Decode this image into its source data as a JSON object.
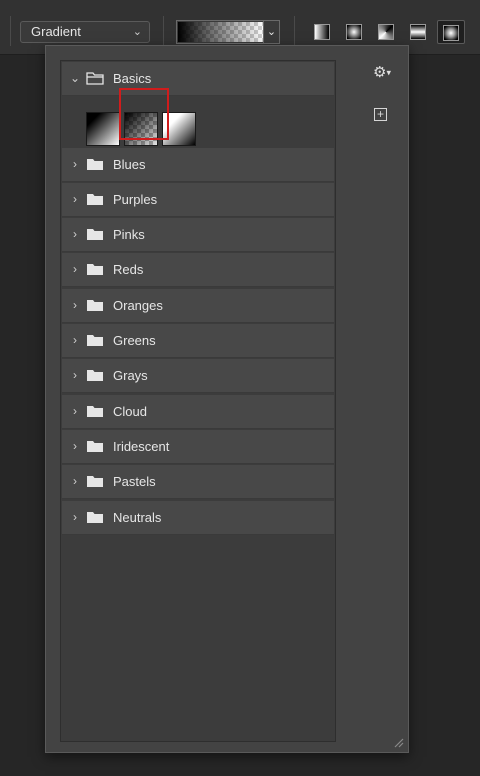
{
  "toolbar": {
    "mode_label": "Gradient",
    "mode_chevron": "⌄",
    "gradient_dropdown_chevron": "⌄",
    "gradient_types": [
      "linear-gradient-icon",
      "radial-gradient-icon",
      "angle-gradient-icon",
      "reflected-gradient-icon",
      "diamond-gradient-icon"
    ]
  },
  "panel": {
    "groups": [
      {
        "label": "Basics",
        "expanded": true
      },
      {
        "label": "Blues",
        "expanded": false
      },
      {
        "label": "Purples",
        "expanded": false
      },
      {
        "label": "Pinks",
        "expanded": false
      },
      {
        "label": "Reds",
        "expanded": false
      },
      {
        "label": "Oranges",
        "expanded": false
      },
      {
        "label": "Greens",
        "expanded": false
      },
      {
        "label": "Grays",
        "expanded": false
      },
      {
        "label": "Cloud",
        "expanded": false
      },
      {
        "label": "Iridescent",
        "expanded": false
      },
      {
        "label": "Pastels",
        "expanded": false
      },
      {
        "label": "Neutrals",
        "expanded": false
      }
    ],
    "basics_swatches": [
      "foreground-to-background",
      "foreground-to-transparent",
      "black-white"
    ],
    "selected_swatch_index": 1,
    "gear_icon": "⚙",
    "gear_chevron": "▾",
    "new_preset_icon": "+"
  },
  "colors": {
    "selection": "#d01c1c",
    "panel_bg": "#434343",
    "app_bg": "#262626"
  }
}
